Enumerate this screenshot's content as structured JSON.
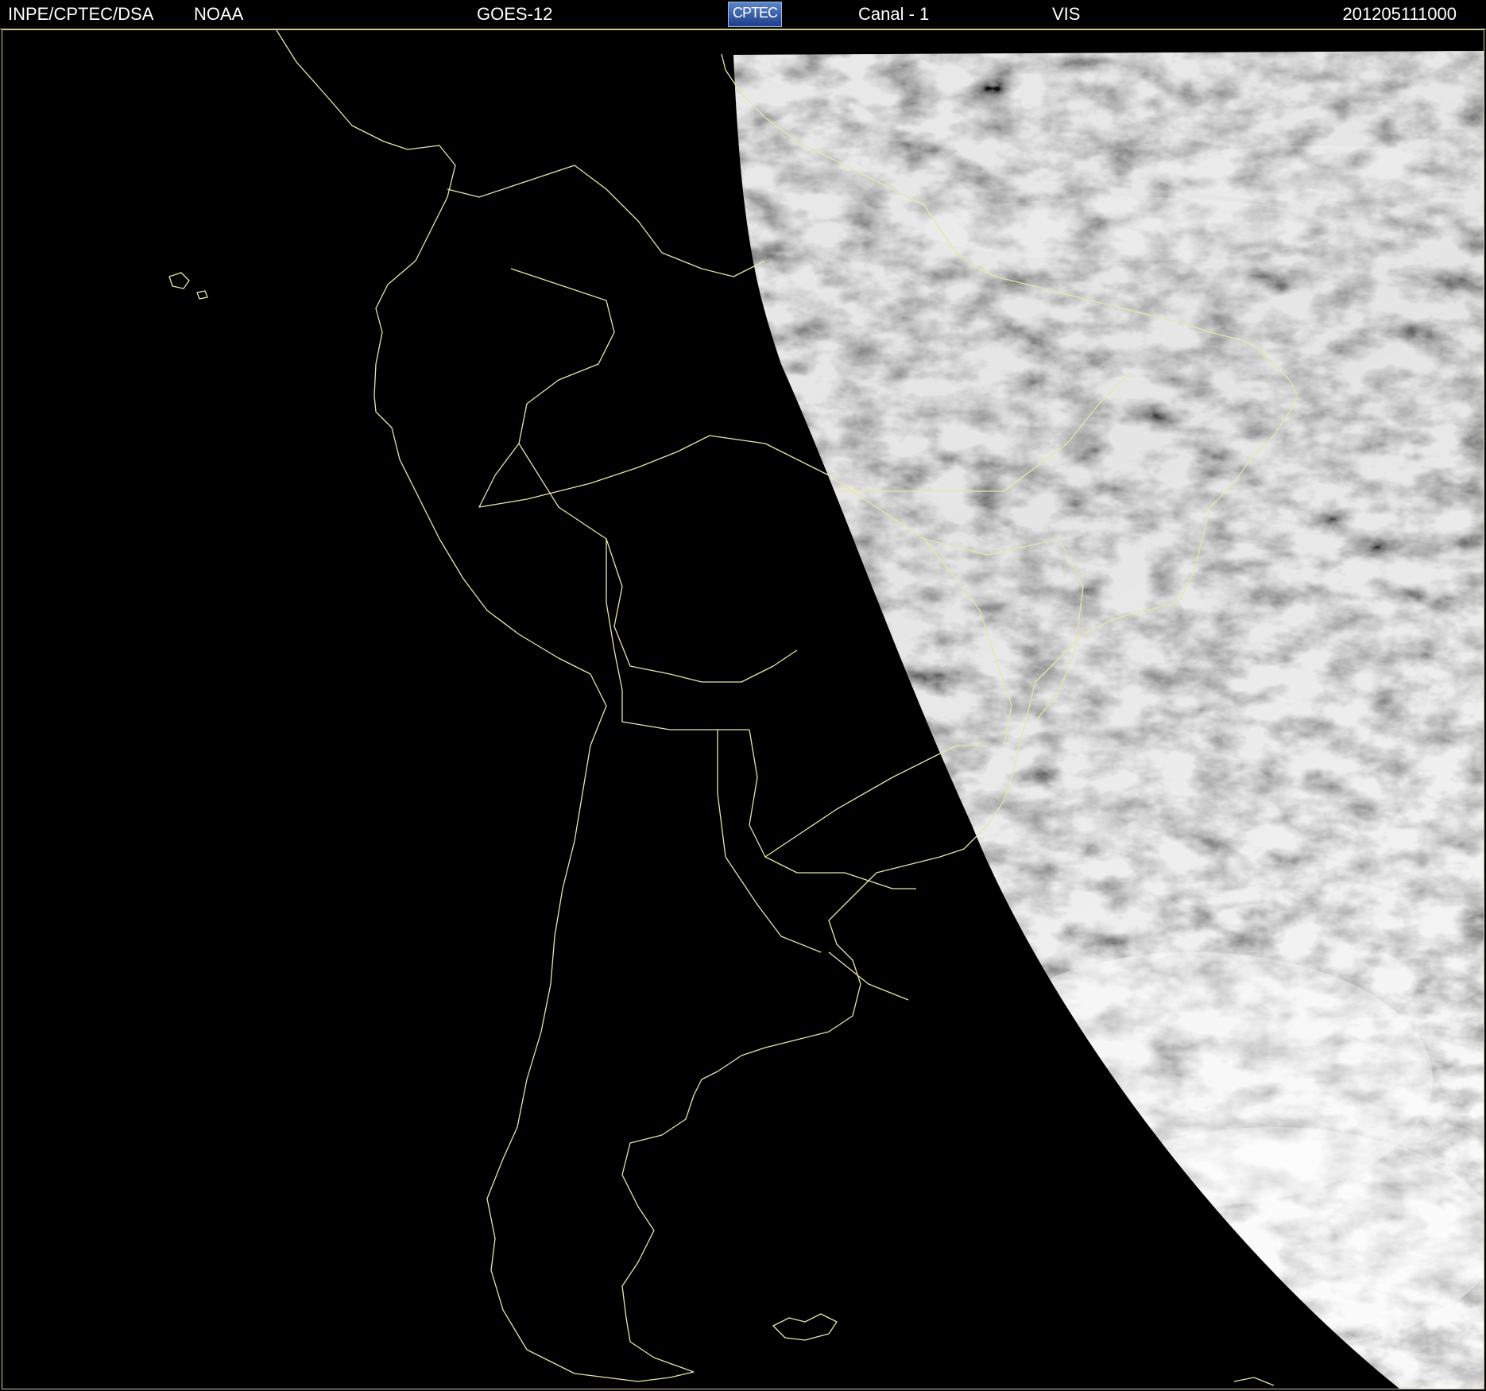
{
  "header": {
    "agency": "INPE/CPTEC/DSA",
    "source": "NOAA",
    "satellite": "GOES-12",
    "logo_text": "CPTEC",
    "channel": "Canal - 1",
    "band": "VIS",
    "timestamp": "201205111000"
  },
  "colors": {
    "background": "#000000",
    "boundaries": "#e6e6a8",
    "header_text": "#ffffff",
    "logo_blue": "#2b56a8"
  },
  "map": {
    "type": "satellite-visible-image",
    "region": "South America",
    "overlay": "political boundaries",
    "illumination": "partial (terminator)"
  }
}
